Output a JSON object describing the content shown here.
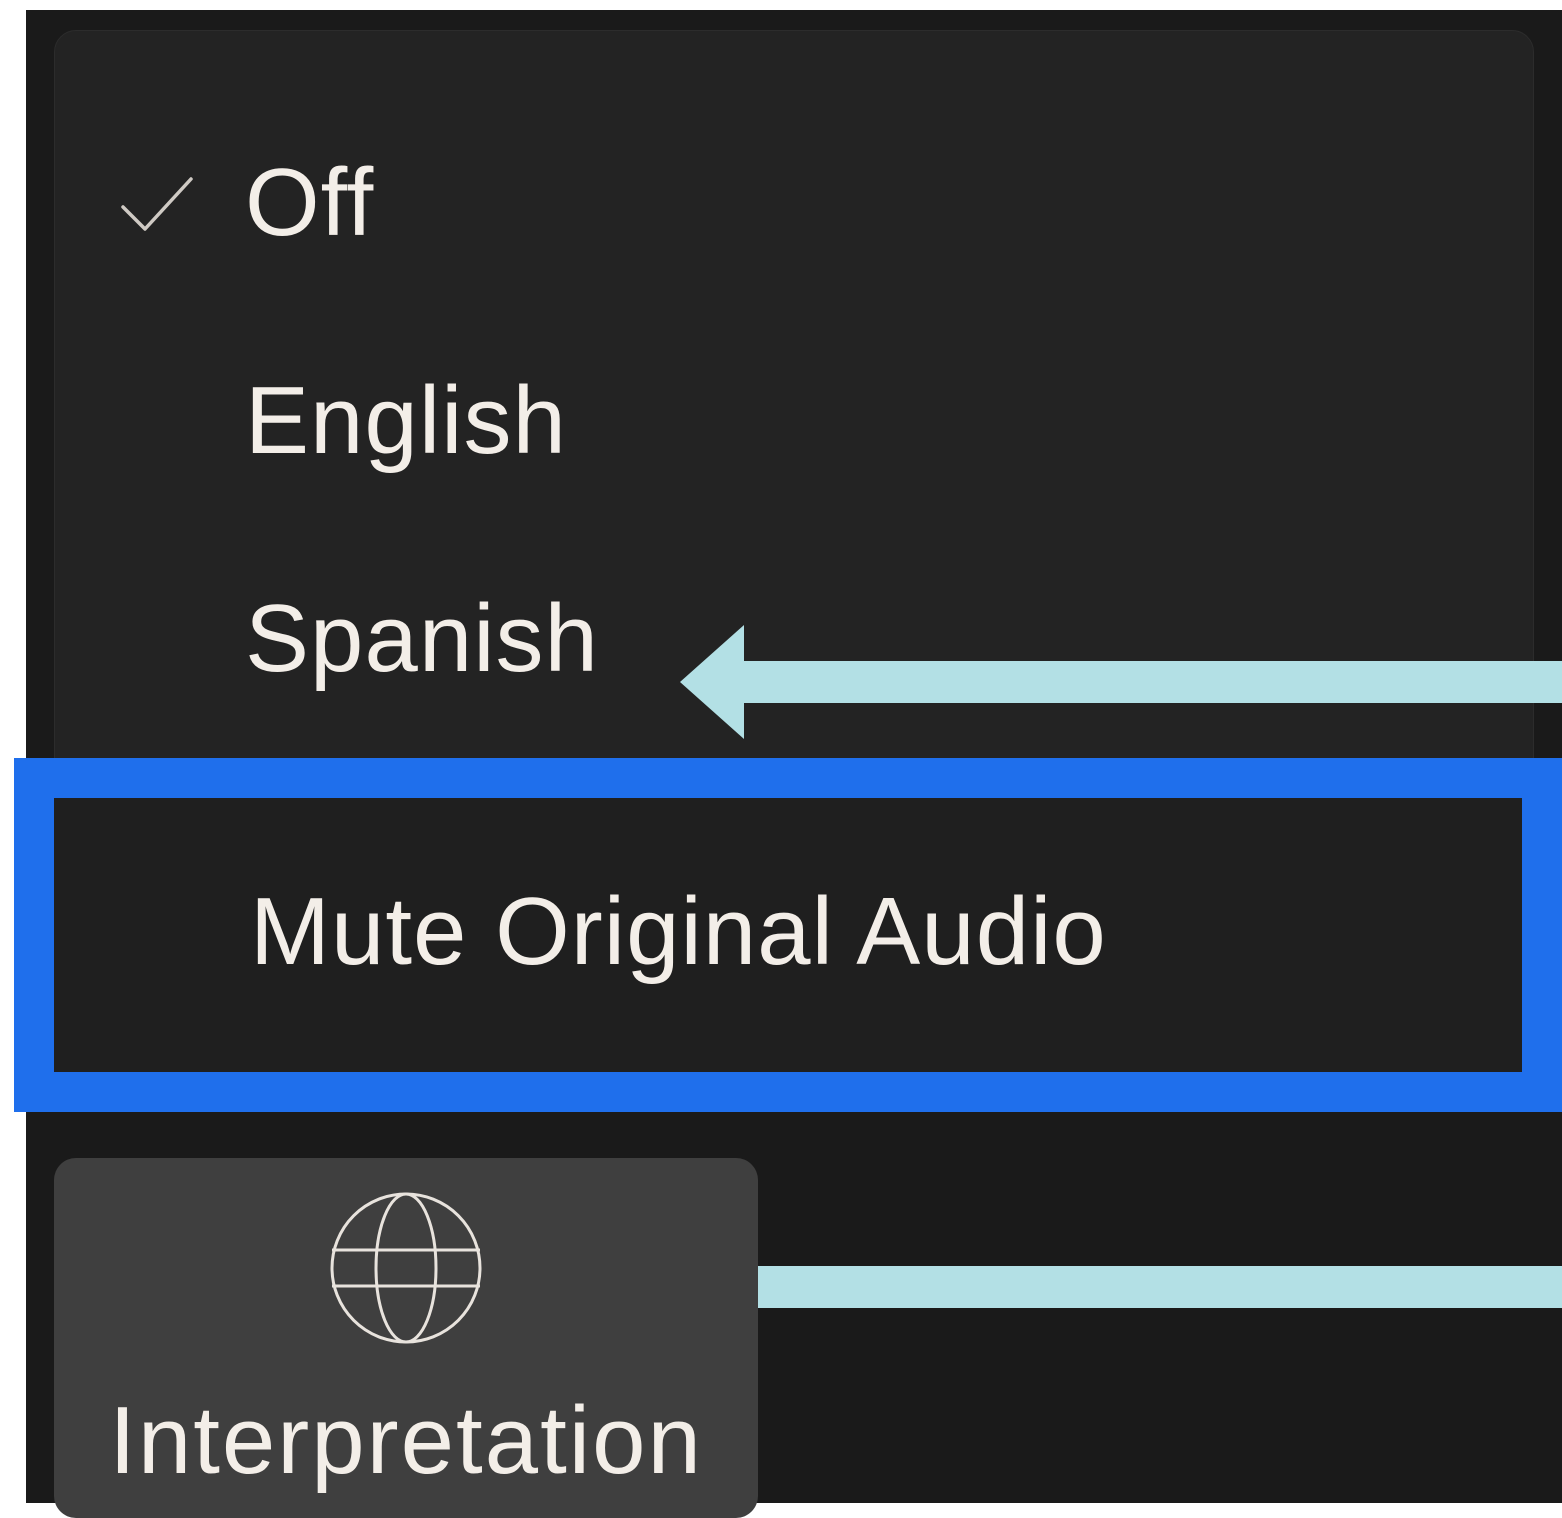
{
  "menu": {
    "items": [
      {
        "label": "Off",
        "checked": true
      },
      {
        "label": "English",
        "checked": false
      },
      {
        "label": "Spanish",
        "checked": false
      }
    ],
    "mute_label": "Mute Original Audio"
  },
  "toolbar": {
    "interpretation_label": "Interpretation",
    "icon": "globe-icon"
  },
  "annotations": {
    "highlight_color": "#1f6fec",
    "arrow_color": "#b3e0e5"
  },
  "theme": {
    "background": "#1a1a1a",
    "panel": "#232323",
    "text": "#f3eee8",
    "button": "#3f3f3f"
  }
}
